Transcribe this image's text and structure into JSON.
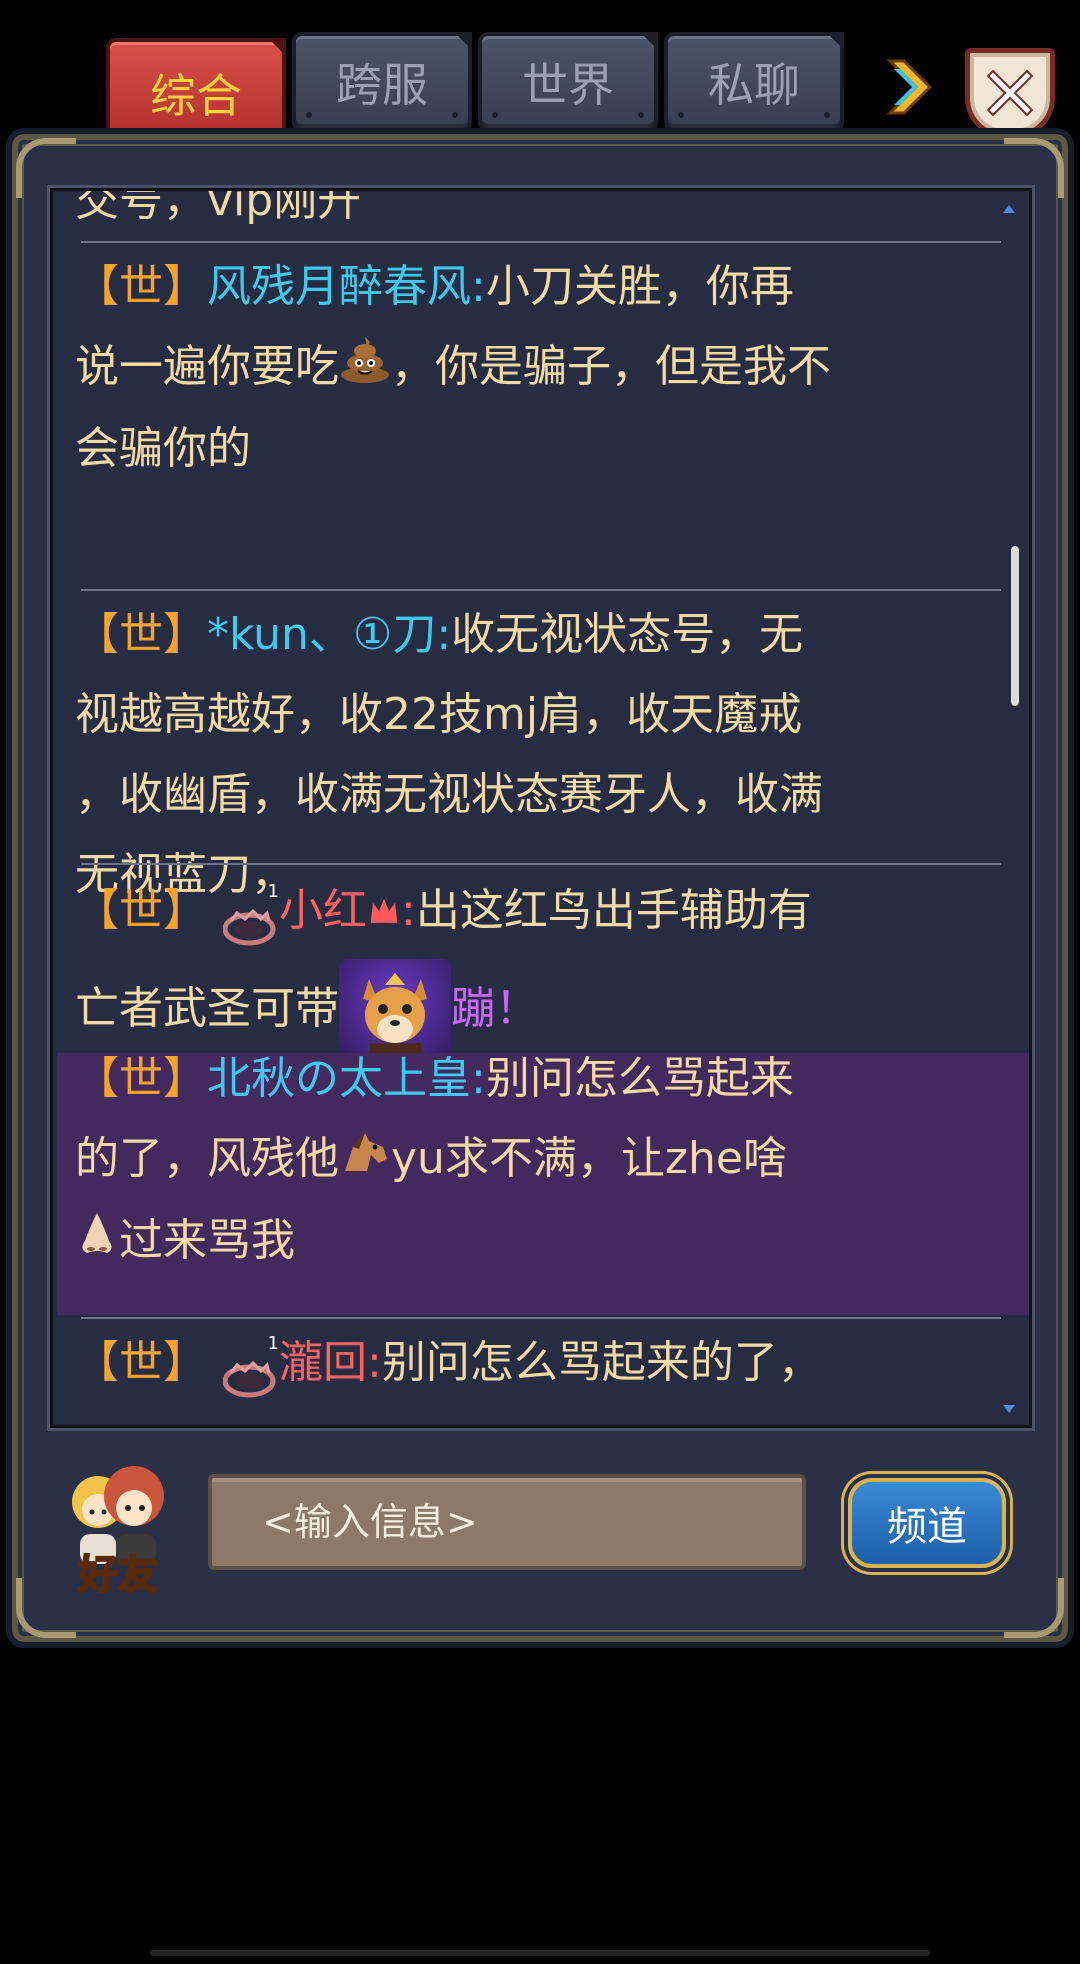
{
  "tabs": [
    {
      "label": "综合",
      "active": true
    },
    {
      "label": "跨服",
      "active": false
    },
    {
      "label": "世界",
      "active": false
    },
    {
      "label": "私聊",
      "active": false
    }
  ],
  "top_message_fragment": "交号，vip刚升",
  "messages": [
    {
      "channel": "【世】",
      "sender": "风残月醉春风:",
      "lines": [
        "小刀关胜，你再",
        "说一遍你要吃",
        "，你是骗子，但是我不",
        "会骗你的"
      ]
    },
    {
      "channel": "【世】",
      "sender": "*kun、①刀:",
      "lines": [
        "收无视状态号，无",
        "视越高越好，收22技mj肩，收天魔戒",
        "，收幽盾，收满无视状态赛牙人，收满",
        "无视蓝刀，"
      ]
    },
    {
      "channel": "【世】",
      "vip_level": "1",
      "sender": "小红",
      "sender_suffix": ":",
      "lines": [
        "出这红鸟出手辅助有",
        "亡者武圣可带"
      ],
      "link_text": "蹦！"
    },
    {
      "channel": "【世】",
      "sender": "北秋の太上皇:",
      "lines": [
        "别问怎么骂起来",
        "的了，风残他",
        "yu求不满，让zhe啥",
        "过来骂我"
      ]
    },
    {
      "channel": "【世】",
      "vip_level": "1",
      "sender": "瀧回:",
      "lines": [
        "别问怎么骂起来的了，"
      ]
    }
  ],
  "input": {
    "placeholder": "<输入信息>"
  },
  "friends_label": "好友",
  "channel_button": "频道",
  "colors": {
    "channel_tag": "#f6a32a",
    "name_blue": "#3ec9f0",
    "name_red": "#ff6060",
    "text": "#f3d9a3",
    "highlight_bg": "#44295e"
  }
}
